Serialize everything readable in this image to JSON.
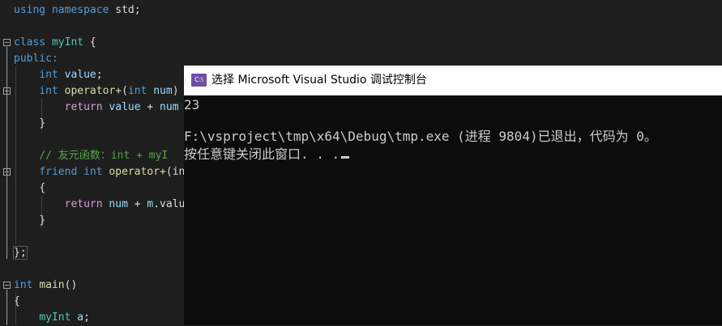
{
  "editor": {
    "line1": {
      "kw1": "using",
      "kw2": "namespace",
      "rest": " std;"
    },
    "line2": {
      "kw": "class",
      "name": "myInt",
      "rest": " {"
    },
    "line3": {
      "kw": "public:"
    },
    "line4": {
      "kw": "int",
      "var": "value",
      "rest": ";"
    },
    "line5": {
      "kw": "int",
      "fn": "operator+",
      "p1": "(",
      "kw2": "int",
      "var": "num",
      "rest": ")"
    },
    "line6": {
      "kw": "return",
      "var1": "value",
      "op": " + ",
      "var2": "num"
    },
    "line7": {
      "text": "}"
    },
    "line9": {
      "comment": "// 友元函数：int + myI"
    },
    "line10": {
      "kw": "friend",
      "kw2": "int",
      "fn": "operator+",
      "rest": "(in"
    },
    "line11": {
      "text": "{"
    },
    "line12": {
      "kw": "return",
      "var1": "num",
      "op": " + ",
      "var2": "m",
      "rest": ".valu"
    },
    "line13": {
      "text": "}"
    },
    "line15": {
      "text": "};"
    },
    "line17": {
      "kw": "int",
      "fn": "main",
      "rest": "()"
    },
    "line18": {
      "text": "{"
    },
    "line19": {
      "cls": "myInt",
      "var": "a",
      "rest": ";"
    }
  },
  "console": {
    "title": "选择 Microsoft Visual Studio 调试控制台",
    "icon": "visual-studio-icon",
    "icon_text": "C:\\",
    "output": "23",
    "exit_line": "F:\\vsproject\\tmp\\x64\\Debug\\tmp.exe (进程 9804)已退出，代码为 0。",
    "prompt_line": "按任意键关闭此窗口. . ."
  },
  "colors": {
    "keyword": "#569cd6",
    "class": "#4ec9b0",
    "function": "#dcdcaa",
    "variable": "#9cdcfe",
    "comment": "#57a64a",
    "console_bg": "#0c0c0c",
    "editor_bg": "#1e1e1e"
  }
}
